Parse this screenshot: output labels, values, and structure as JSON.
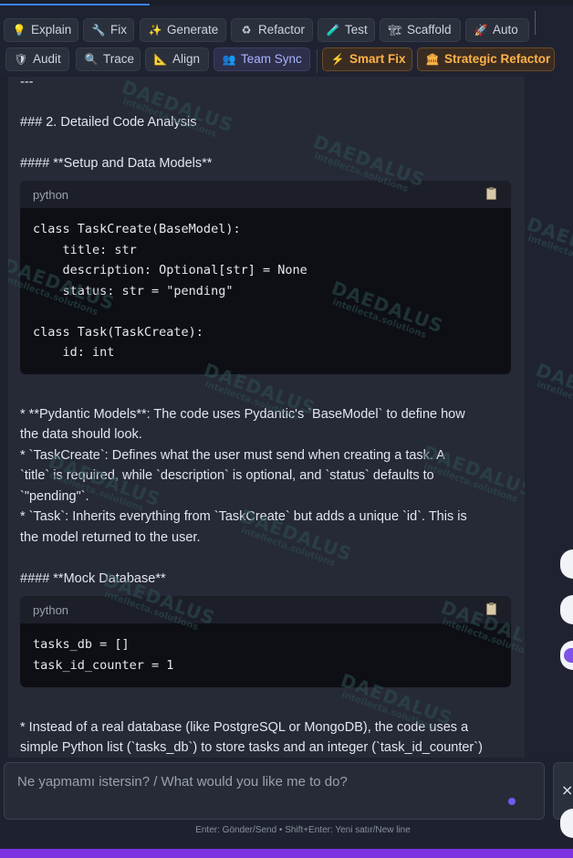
{
  "toolbar": {
    "row1": [
      {
        "name": "explain-button",
        "icon": "💡",
        "icon_name": "lightbulb-icon",
        "label": "Explain"
      },
      {
        "name": "fix-button",
        "icon": "🔧",
        "icon_name": "wrench-icon",
        "label": "Fix"
      },
      {
        "name": "generate-button",
        "icon": "✨",
        "icon_name": "sparkles-icon",
        "label": "Generate"
      },
      {
        "name": "refactor-button",
        "icon": "♻",
        "icon_name": "recycle-icon",
        "label": "Refactor"
      },
      {
        "name": "test-button",
        "icon": "🧪",
        "icon_name": "test-tube-icon",
        "label": "Test"
      },
      {
        "name": "scaffold-button",
        "icon": "🏗",
        "icon_name": "scaffold-icon",
        "label": "Scaffold"
      },
      {
        "name": "auto-button",
        "icon": "🚀",
        "icon_name": "rocket-icon",
        "label": "Auto"
      }
    ],
    "row2": [
      {
        "name": "audit-button",
        "icon": "🛡",
        "icon_name": "shield-icon",
        "label": "Audit"
      },
      {
        "name": "trace-button",
        "icon": "🔍",
        "icon_name": "magnifier-icon",
        "label": "Trace"
      },
      {
        "name": "align-button",
        "icon": "📐",
        "icon_name": "ruler-icon",
        "label": "Align"
      },
      {
        "name": "team-sync-button",
        "icon": "👥",
        "icon_name": "team-icon",
        "label": "Team Sync"
      },
      {
        "name": "smart-fix-button",
        "icon": "⚡",
        "icon_name": "lightning-icon",
        "label": "Smart Fix"
      },
      {
        "name": "strategic-refactor-button",
        "icon": "🏛",
        "icon_name": "building-icon",
        "label": "Strategic Refactor"
      }
    ]
  },
  "message": {
    "hr": "---",
    "heading_analysis": "### 2. Detailed Code Analysis",
    "heading_setup": "#### **Setup and Data Models**",
    "code1_lang": "python",
    "code1": "class TaskCreate(BaseModel):\n    title: str\n    description: Optional[str] = None\n    status: str = \"pending\"\n\nclass Task(TaskCreate):\n    id: int",
    "bullets1_l1": "*   **Pydantic Models**: The code uses Pydantic's `BaseModel` to define how",
    "bullets1_l2": "the data should look.",
    "bullets1_l3": "*   `TaskCreate`: Defines what the user must send when creating a task. A",
    "bullets1_l4": "`title` is required, while `description` is optional, and `status` defaults to",
    "bullets1_l5": "`\"pending\"`.",
    "bullets1_l6": "*   `Task`: Inherits everything from `TaskCreate` but adds a unique `id`. This is",
    "bullets1_l7": "the model returned to the user.",
    "heading_mock": "#### **Mock Database**",
    "code2_lang": "python",
    "code2": "tasks_db = []\ntask_id_counter = 1",
    "bullets2_l1": "*   Instead of a real database (like PostgreSQL or MongoDB), the code uses a",
    "bullets2_l2": "simple Python list (`tasks_db`) to store tasks and an integer (`task_id_counter`)"
  },
  "watermark": {
    "big": "DAEDALUS",
    "small": "intellecta.solutions"
  },
  "input": {
    "placeholder": "Ne yapmamı istersin? / What would you like me to do?"
  },
  "hint": "Enter: Gönder/Send • Shift+Enter: Yeni satır/New line",
  "colors": {
    "accent": "#3b82f6",
    "orange": "#ffb347",
    "status_bar": "#7e33e0",
    "indicator": "#6d5cf0"
  }
}
